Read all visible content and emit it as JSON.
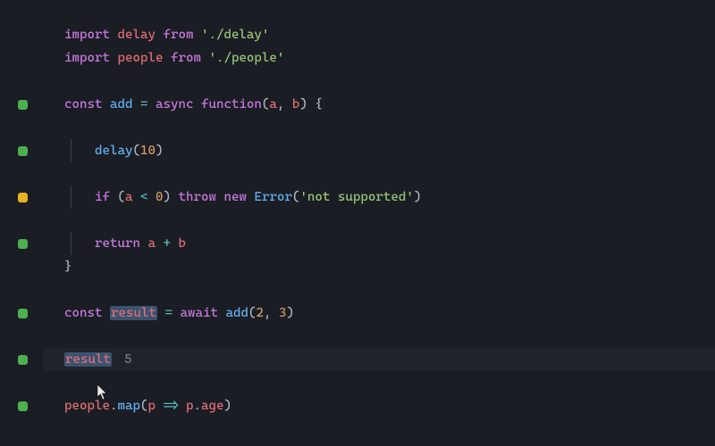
{
  "lines": {
    "l1": {
      "tokens": [
        {
          "t": "import ",
          "c": "kw"
        },
        {
          "t": "delay ",
          "c": "id"
        },
        {
          "t": "from ",
          "c": "kw"
        },
        {
          "t": "'./delay'",
          "c": "str"
        }
      ]
    },
    "l2": {
      "tokens": [
        {
          "t": "import ",
          "c": "kw"
        },
        {
          "t": "people ",
          "c": "id"
        },
        {
          "t": "from ",
          "c": "kw"
        },
        {
          "t": "'./people'",
          "c": "str"
        }
      ]
    },
    "l4": {
      "marker": "green",
      "tokens": [
        {
          "t": "const ",
          "c": "kw"
        },
        {
          "t": "add ",
          "c": "fn"
        },
        {
          "t": "= ",
          "c": "op"
        },
        {
          "t": "async ",
          "c": "kw"
        },
        {
          "t": "function",
          "c": "kw"
        },
        {
          "t": "(",
          "c": "txt"
        },
        {
          "t": "a",
          "c": "id"
        },
        {
          "t": ", ",
          "c": "txt"
        },
        {
          "t": "b",
          "c": "id"
        },
        {
          "t": ") {",
          "c": "txt"
        }
      ]
    },
    "l6": {
      "marker": "green",
      "guide": true,
      "indent": "    ",
      "tokens": [
        {
          "t": "delay",
          "c": "fn"
        },
        {
          "t": "(",
          "c": "txt"
        },
        {
          "t": "10",
          "c": "num"
        },
        {
          "t": ")",
          "c": "txt"
        }
      ]
    },
    "l8": {
      "marker": "yellow",
      "guide": true,
      "indent": "    ",
      "tokens": [
        {
          "t": "if ",
          "c": "kw"
        },
        {
          "t": "(",
          "c": "txt"
        },
        {
          "t": "a ",
          "c": "id"
        },
        {
          "t": "< ",
          "c": "op"
        },
        {
          "t": "0",
          "c": "num"
        },
        {
          "t": ") ",
          "c": "txt"
        },
        {
          "t": "throw ",
          "c": "kw"
        },
        {
          "t": "new ",
          "c": "kw"
        },
        {
          "t": "Error",
          "c": "fn"
        },
        {
          "t": "(",
          "c": "txt"
        },
        {
          "t": "'not supported'",
          "c": "str"
        },
        {
          "t": ")",
          "c": "txt"
        }
      ]
    },
    "l10": {
      "marker": "green",
      "guide": true,
      "indent": "    ",
      "tokens": [
        {
          "t": "return ",
          "c": "kw"
        },
        {
          "t": "a ",
          "c": "id"
        },
        {
          "t": "+ ",
          "c": "op"
        },
        {
          "t": "b",
          "c": "id"
        }
      ]
    },
    "l11": {
      "tokens": [
        {
          "t": "}",
          "c": "txt"
        }
      ]
    },
    "l13": {
      "marker": "green",
      "tokens": [
        {
          "t": "const ",
          "c": "kw"
        },
        {
          "t": "result",
          "c": "id",
          "hl": true
        },
        {
          "t": " ",
          "c": "txt"
        },
        {
          "t": "= ",
          "c": "op"
        },
        {
          "t": "await ",
          "c": "kw"
        },
        {
          "t": "add",
          "c": "fn"
        },
        {
          "t": "(",
          "c": "txt"
        },
        {
          "t": "2",
          "c": "num"
        },
        {
          "t": ", ",
          "c": "txt"
        },
        {
          "t": "3",
          "c": "num"
        },
        {
          "t": ")",
          "c": "txt"
        }
      ]
    },
    "l15": {
      "marker": "green",
      "current": true,
      "tokens": [
        {
          "t": "result",
          "c": "id",
          "hl": true
        }
      ],
      "inline_value": "5"
    },
    "l17": {
      "marker": "green",
      "tokens": [
        {
          "t": "people",
          "c": "id"
        },
        {
          "t": ".",
          "c": "txt"
        },
        {
          "t": "map",
          "c": "fn"
        },
        {
          "t": "(",
          "c": "txt"
        },
        {
          "t": "p ",
          "c": "id"
        },
        {
          "t": "=> ",
          "c": "op"
        },
        {
          "t": "p",
          "c": "id"
        },
        {
          "t": ".",
          "c": "txt"
        },
        {
          "t": "age",
          "c": "id"
        },
        {
          "t": ")",
          "c": "txt"
        }
      ]
    }
  },
  "order": [
    "l1",
    "l2",
    "",
    "l4",
    "",
    "l6",
    "",
    "l8",
    "",
    "l10",
    "l11",
    "",
    "l13",
    "",
    "l15",
    "",
    "l17"
  ]
}
